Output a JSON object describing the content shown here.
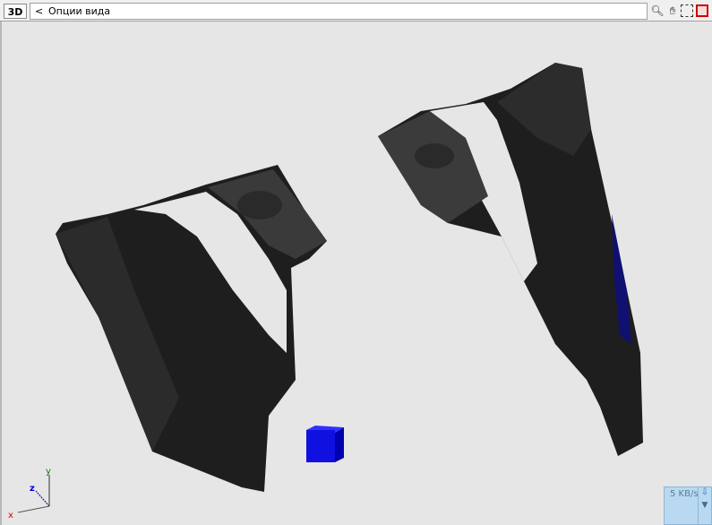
{
  "toolbar": {
    "mode_button": "3D",
    "back_label": "<",
    "title": "Опции вида",
    "icons": [
      "zoom-icon",
      "pan-hand-icon",
      "fit-view-icon",
      "stop-icon"
    ]
  },
  "axes": {
    "x": "x",
    "y": "y",
    "z": "z"
  },
  "network": {
    "speed": "5 KB/s"
  },
  "colors": {
    "background": "#e6e6e6",
    "model": "#1c1c1c",
    "cube": "#1010e0",
    "x_axis": "#e00000",
    "y_axis": "#008000",
    "z_axis": "#0000e0"
  }
}
